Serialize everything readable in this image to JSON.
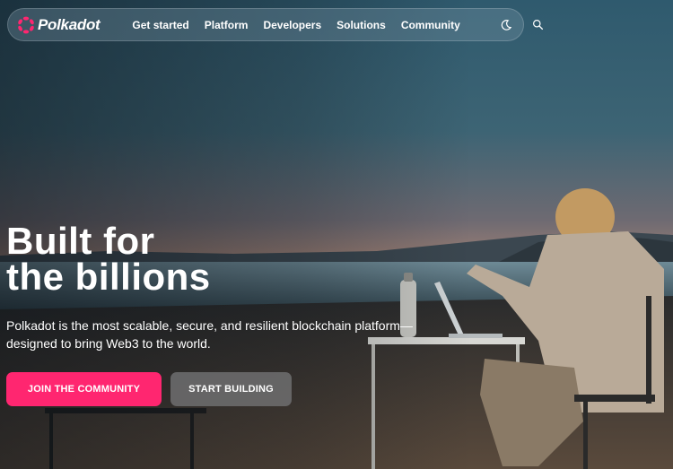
{
  "brand": {
    "name": "Polkadot",
    "accent": "#ff2670"
  },
  "nav": {
    "items": [
      "Get started",
      "Platform",
      "Developers",
      "Solutions",
      "Community"
    ],
    "icons": [
      "moon-icon",
      "search-icon"
    ]
  },
  "hero": {
    "headline_line1": "Built for",
    "headline_line2": "the billions",
    "subtitle": "Polkadot is the most scalable, secure, and resilient blockchain platform—designed to bring Web3 to the world."
  },
  "cta": {
    "primary_label": "JOIN THE COMMUNITY",
    "secondary_label": "START BUILDING"
  }
}
